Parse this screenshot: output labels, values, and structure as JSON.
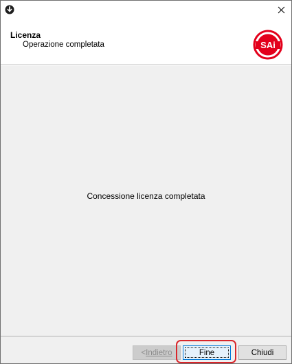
{
  "window": {
    "close_glyph": "×"
  },
  "header": {
    "title": "Licenza",
    "subtitle": "Operazione completata",
    "logo_text": "SAi",
    "logo_color": "#e3001b"
  },
  "content": {
    "message": "Concessione licenza completata"
  },
  "footer": {
    "back_prefix": "< ",
    "back_label": "Indietro",
    "finish_label": "Fine",
    "close_label": "Chiudi",
    "highlight_color": "#d9262b"
  }
}
